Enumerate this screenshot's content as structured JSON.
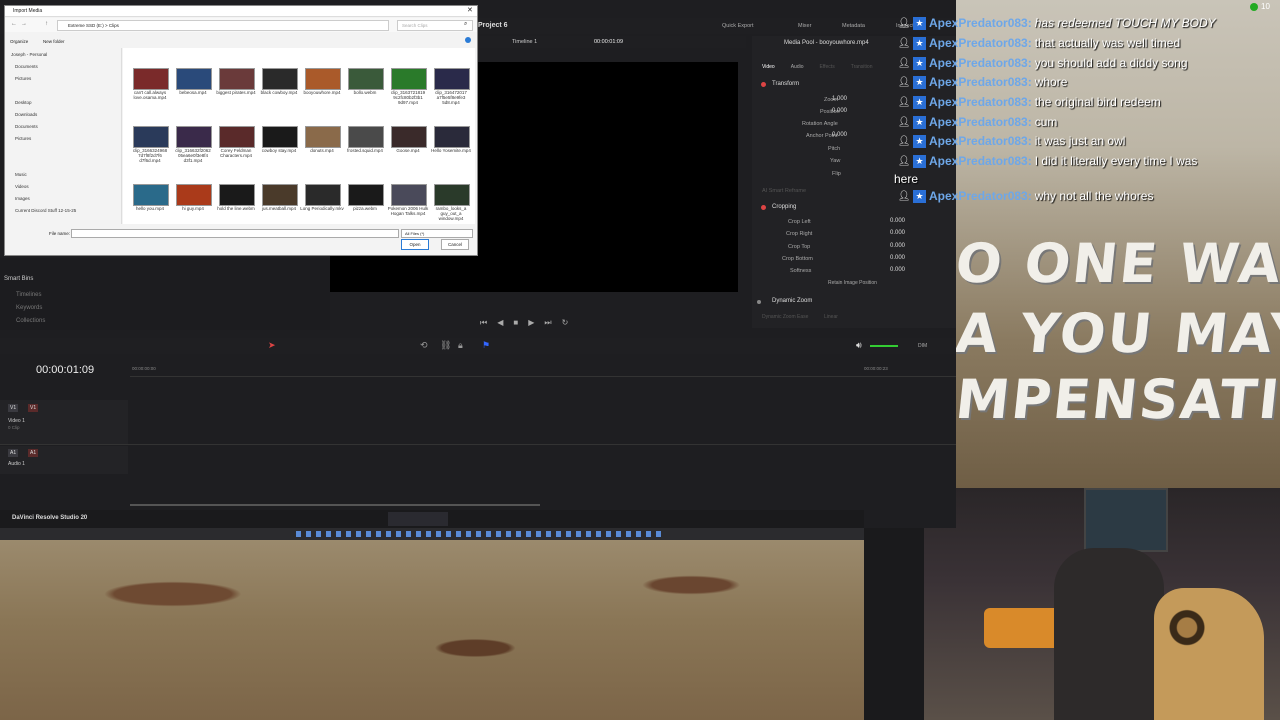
{
  "dialog": {
    "title": "Import Media",
    "path": "Extreme SSD (E:) > Clips",
    "search_placeholder": "Search Clips",
    "organize": "Organize",
    "new_folder": "New folder",
    "sidebar": [
      "Joseph - Personal",
      "Documents",
      "Pictures",
      "Desktop",
      "Downloads",
      "Documents",
      "Pictures",
      "",
      "Music",
      "Videos",
      "",
      "Images",
      "Current Discord Stuff 12-15-25"
    ],
    "thumbs": [
      {
        "label": "can't call.always love.osama.mp4"
      },
      {
        "label": "bebeosa.mp4"
      },
      {
        "label": "biggest pirates.mp4"
      },
      {
        "label": "black cowboy.mp4"
      },
      {
        "label": "booyouwhore.mp4"
      },
      {
        "label": "bollo.webm"
      },
      {
        "label": "clip_3163721819 9c2fc80b2f3b1 9d97.mp4"
      },
      {
        "label": "clip_316472017 a7f5e5f8e9fe3 5d8.mp4"
      },
      {
        "label": "clip_3166324968 7d7f8f2d7f6 d7f6d.mp4"
      },
      {
        "label": "clip_316632f2062 05ea6e0f3e8f4 d3f1.mp4"
      },
      {
        "label": "Corey Feldman Characters.mp4"
      },
      {
        "label": "cowboy stay.mp4"
      },
      {
        "label": "donuts.mp4"
      },
      {
        "label": "frosted.squid.mp4"
      },
      {
        "label": "Goose.mp4"
      },
      {
        "label": "Hello Yosemite.mp4"
      },
      {
        "label": "hello you.mp4"
      },
      {
        "label": "hi guy.mp4"
      },
      {
        "label": "hold the line.webm"
      },
      {
        "label": "jus.meatball.mp4"
      },
      {
        "label": "Long Periodically.mkv"
      },
      {
        "label": "pizza.webm"
      },
      {
        "label": "Pokemon 2006 Hulk Hogan Talks.mp4"
      },
      {
        "label": "rambo_looks_a guy_out_a window.mp4"
      }
    ],
    "filename_label": "File name:",
    "filetype": "All Files (*)",
    "open": "Open",
    "cancel": "Cancel"
  },
  "resolve": {
    "project": "Project 6",
    "timeline": "Timeline 1",
    "timecode": "00:00:01:09",
    "quick_export": "Quick Export",
    "mixer": "Mixer",
    "metadata": "Metadata",
    "inspector": "Inspector",
    "media_pool_clip": "Media Pool - booyouwhore.mp4",
    "insp_tabs": [
      "Video",
      "Audio",
      "Effects",
      "Transition"
    ],
    "transform": "Transform",
    "zoom_label": "Zoom",
    "zoom_x": "1.000",
    "position_label": "Position",
    "position_x": "0.000",
    "rotation_label": "Rotation Angle",
    "anchor_label": "Anchor Point",
    "anchor_x": "0.000",
    "pitch_label": "Pitch",
    "yaw_label": "Yaw",
    "flip_label": "Flip",
    "smart_reframe": "AI Smart Reframe",
    "cropping": "Cropping",
    "crop_left": "Crop Left",
    "crop_right": "Crop Right",
    "crop_top": "Crop Top",
    "crop_bottom": "Crop Bottom",
    "softness": "Softness",
    "crop_vals": [
      "0.000",
      "0.000",
      "0.000",
      "0.000",
      "0.000"
    ],
    "retain": "Retain Image Position",
    "dynamic_zoom": "Dynamic Zoom",
    "dz_ease": "Dynamic Zoom Ease",
    "dz_linear": "Linear",
    "smart_bins": "Smart Bins",
    "bins": [
      "Timelines",
      "Keywords",
      "Collections"
    ],
    "big_timecode": "00:00:01:09",
    "ruler_start": "00:00:00:00",
    "ruler_end": "00:00:00:23",
    "video_track": "Video 1",
    "video_clips": "0 Clip",
    "audio_track": "Audio 1",
    "v1": "V1",
    "a1": "A1",
    "dim": "DIM",
    "app_name": "DaVinci Resolve Studio 20"
  },
  "chat": [
    {
      "user": "ApexPredator083:",
      "msg": "has redeemed TOUCH MY BODY",
      "italic": true
    },
    {
      "user": "ApexPredator083:",
      "msg": "that actually was well timed"
    },
    {
      "user": "ApexPredator083:",
      "msg": "you should add a diddy song"
    },
    {
      "user": "ApexPredator083:",
      "msg": "whore"
    },
    {
      "user": "ApexPredator083:",
      "msg": "the original bird redeem"
    },
    {
      "user": "ApexPredator083:",
      "msg": "cum"
    },
    {
      "user": "ApexPredator083:",
      "msg": "it was just an owl"
    },
    {
      "user": "ApexPredator083:",
      "msg": "I did it literally every time I was"
    },
    {
      "user": "",
      "msg": "here"
    },
    {
      "user": "ApexPredator083:",
      "msg": "why not all the whores"
    }
  ],
  "sign_lines": [
    "O ONE WAS",
    "A YOU MAY",
    "MPENSATION"
  ],
  "viewer_count": "10",
  "colors": {
    "accent_chat_user": "#6ea7e8",
    "resolve_bg": "#1e1e21",
    "inspector_red": "#d44444"
  }
}
